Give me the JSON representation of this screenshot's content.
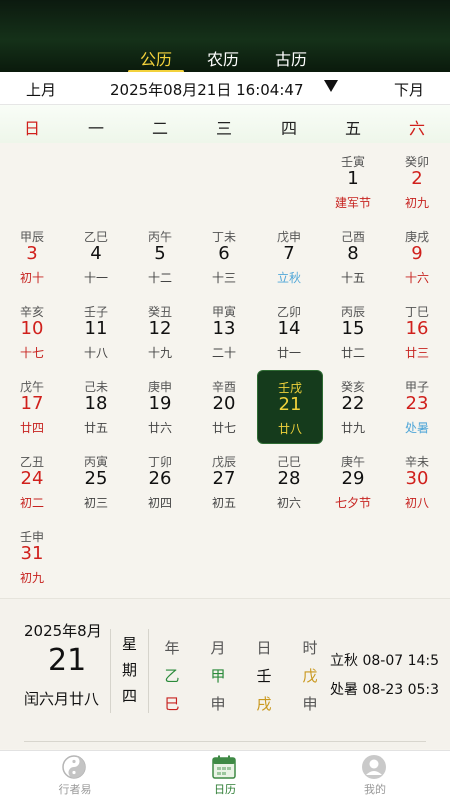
{
  "top_tabs": [
    {
      "label": "公历",
      "active": true
    },
    {
      "label": "农历",
      "active": false
    },
    {
      "label": "古历",
      "active": false
    }
  ],
  "nav": {
    "prev": "上月",
    "date": "2025年08月21日 16:04:47",
    "next": "下月"
  },
  "weekdays": [
    "日",
    "一",
    "二",
    "三",
    "四",
    "五",
    "六"
  ],
  "weeks": [
    [
      null,
      null,
      null,
      null,
      null,
      {
        "gz": "壬寅",
        "num": "1",
        "sub": "建军节",
        "sub_style": "red"
      },
      {
        "gz": "癸卯",
        "num": "2",
        "sub": "初九",
        "sub_style": "red"
      }
    ],
    [
      {
        "gz": "甲辰",
        "num": "3",
        "sub": "初十",
        "sub_style": "red"
      },
      {
        "gz": "乙巳",
        "num": "4",
        "sub": "十一"
      },
      {
        "gz": "丙午",
        "num": "5",
        "sub": "十二"
      },
      {
        "gz": "丁未",
        "num": "6",
        "sub": "十三"
      },
      {
        "gz": "戊申",
        "num": "7",
        "sub": "立秋",
        "sub_style": "blue"
      },
      {
        "gz": "己酉",
        "num": "8",
        "sub": "十五"
      },
      {
        "gz": "庚戌",
        "num": "9",
        "sub": "十六",
        "sub_style": "red"
      }
    ],
    [
      {
        "gz": "辛亥",
        "num": "10",
        "sub": "十七",
        "sub_style": "red"
      },
      {
        "gz": "壬子",
        "num": "11",
        "sub": "十八"
      },
      {
        "gz": "癸丑",
        "num": "12",
        "sub": "十九"
      },
      {
        "gz": "甲寅",
        "num": "13",
        "sub": "二十"
      },
      {
        "gz": "乙卯",
        "num": "14",
        "sub": "廿一"
      },
      {
        "gz": "丙辰",
        "num": "15",
        "sub": "廿二"
      },
      {
        "gz": "丁巳",
        "num": "16",
        "sub": "廿三",
        "sub_style": "red"
      }
    ],
    [
      {
        "gz": "戊午",
        "num": "17",
        "sub": "廿四",
        "sub_style": "red"
      },
      {
        "gz": "己未",
        "num": "18",
        "sub": "廿五"
      },
      {
        "gz": "庚申",
        "num": "19",
        "sub": "廿六"
      },
      {
        "gz": "辛酉",
        "num": "20",
        "sub": "廿七"
      },
      {
        "gz": "壬戌",
        "num": "21",
        "sub": "廿八",
        "today": true
      },
      {
        "gz": "癸亥",
        "num": "22",
        "sub": "廿九"
      },
      {
        "gz": "甲子",
        "num": "23",
        "sub": "处暑",
        "sub_style": "blue"
      }
    ],
    [
      {
        "gz": "乙丑",
        "num": "24",
        "sub": "初二",
        "sub_style": "red"
      },
      {
        "gz": "丙寅",
        "num": "25",
        "sub": "初三"
      },
      {
        "gz": "丁卯",
        "num": "26",
        "sub": "初四"
      },
      {
        "gz": "戊辰",
        "num": "27",
        "sub": "初五"
      },
      {
        "gz": "己巳",
        "num": "28",
        "sub": "初六"
      },
      {
        "gz": "庚午",
        "num": "29",
        "sub": "七夕节",
        "sub_style": "red"
      },
      {
        "gz": "辛未",
        "num": "30",
        "sub": "初八",
        "sub_style": "red"
      }
    ],
    [
      {
        "gz": "壬申",
        "num": "31",
        "sub": "初九",
        "sub_style": "red"
      },
      null,
      null,
      null,
      null,
      null,
      null
    ]
  ],
  "info": {
    "year_month": "2025年8月",
    "day": "21",
    "lunar": "闰六月廿八",
    "weekday_vertical": [
      "星",
      "期",
      "四"
    ],
    "ganzhi_columns": [
      {
        "head": "年",
        "stem": "乙",
        "stem_color": "green",
        "branch": "巳",
        "branch_color": "red"
      },
      {
        "head": "月",
        "stem": "甲",
        "stem_color": "green",
        "branch": "申",
        "branch_color": "gray"
      },
      {
        "head": "日",
        "stem": "壬",
        "stem_color": "black",
        "branch": "戌",
        "branch_color": "gold"
      },
      {
        "head": "时",
        "stem": "戊",
        "stem_color": "gold",
        "branch": "申",
        "branch_color": "gray"
      }
    ],
    "terms": [
      "立秋 08-07 14:5",
      "处暑 08-23 05:3"
    ]
  },
  "tabbar": [
    {
      "label": "行者易",
      "icon": "taiji-icon",
      "active": false
    },
    {
      "label": "日历",
      "icon": "calendar-icon",
      "active": true
    },
    {
      "label": "我的",
      "icon": "user-icon",
      "active": false
    }
  ]
}
